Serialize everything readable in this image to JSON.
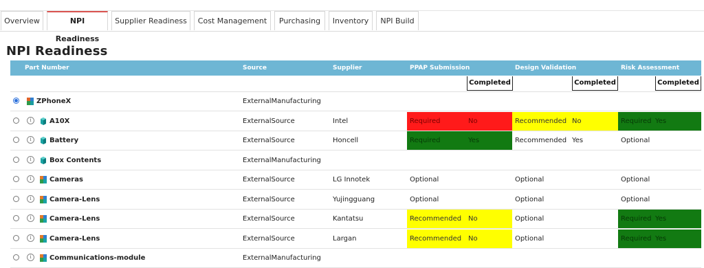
{
  "tabs": [
    {
      "label": "Overview",
      "active": false
    },
    {
      "label": "NPI Readiness",
      "active": true
    },
    {
      "label": "Supplier Readiness",
      "active": false
    },
    {
      "label": "Cost Management",
      "active": false
    },
    {
      "label": "Purchasing",
      "active": false
    },
    {
      "label": "Inventory",
      "active": false
    },
    {
      "label": "NPI Build",
      "active": false
    }
  ],
  "page_title": "NPI Readiness",
  "columns": {
    "part_number": "Part Number",
    "source": "Source",
    "supplier": "Supplier",
    "ppap": "PPAP Submission",
    "design": "Design Validation",
    "risk": "Risk Assessment"
  },
  "sub_header": {
    "ppap": "Completed",
    "design": "Completed",
    "risk": "Completed"
  },
  "colors": {
    "header": "#6eb6d4",
    "required_no": "#ff1a1a",
    "yes": "#127a12",
    "recommended": "#ffff00",
    "active_tab": "#d9534f"
  },
  "rows": [
    {
      "part": "ZPhoneX",
      "selected": true,
      "info": false,
      "icon": "product-icon",
      "source": "ExternalManufacturing",
      "supplier": "",
      "ppap": {
        "level": "",
        "status": "",
        "color": ""
      },
      "design": {
        "level": "",
        "status": "",
        "color": ""
      },
      "risk": {
        "level": "",
        "status": "",
        "color": ""
      }
    },
    {
      "part": "A10X",
      "selected": false,
      "info": true,
      "icon": "part-icon",
      "source": "ExternalSource",
      "supplier": "Intel",
      "ppap": {
        "level": "Required",
        "status": "No",
        "color": "red"
      },
      "design": {
        "level": "Recommended",
        "status": "No",
        "color": "yellow"
      },
      "risk": {
        "level": "Required",
        "status": "Yes",
        "color": "green"
      }
    },
    {
      "part": "Battery",
      "selected": false,
      "info": true,
      "icon": "part-icon",
      "source": "ExternalSource",
      "supplier": "Honcell",
      "ppap": {
        "level": "Required",
        "status": "Yes",
        "color": "green"
      },
      "design": {
        "level": "Recommended",
        "status": "Yes",
        "color": ""
      },
      "risk": {
        "level": "Optional",
        "status": "",
        "color": ""
      }
    },
    {
      "part": "Box Contents",
      "selected": false,
      "info": true,
      "icon": "part-icon",
      "source": "ExternalManufacturing",
      "supplier": "",
      "ppap": {
        "level": "",
        "status": "",
        "color": ""
      },
      "design": {
        "level": "",
        "status": "",
        "color": ""
      },
      "risk": {
        "level": "",
        "status": "",
        "color": ""
      }
    },
    {
      "part": "Cameras",
      "selected": false,
      "info": true,
      "icon": "assembly-icon",
      "source": "ExternalSource",
      "supplier": "LG Innotek",
      "ppap": {
        "level": "Optional",
        "status": "",
        "color": ""
      },
      "design": {
        "level": "Optional",
        "status": "",
        "color": ""
      },
      "risk": {
        "level": "Optional",
        "status": "",
        "color": ""
      }
    },
    {
      "part": "Camera-Lens",
      "selected": false,
      "info": true,
      "icon": "assembly-icon",
      "source": "ExternalSource",
      "supplier": "Yujingguang",
      "ppap": {
        "level": "Optional",
        "status": "",
        "color": ""
      },
      "design": {
        "level": "Optional",
        "status": "",
        "color": ""
      },
      "risk": {
        "level": "Optional",
        "status": "",
        "color": ""
      }
    },
    {
      "part": "Camera-Lens",
      "selected": false,
      "info": true,
      "icon": "assembly-icon",
      "source": "ExternalSource",
      "supplier": "Kantatsu",
      "ppap": {
        "level": "Recommended",
        "status": "No",
        "color": "yellow"
      },
      "design": {
        "level": "Optional",
        "status": "",
        "color": ""
      },
      "risk": {
        "level": "Required",
        "status": "Yes",
        "color": "green"
      }
    },
    {
      "part": "Camera-Lens",
      "selected": false,
      "info": true,
      "icon": "assembly-icon",
      "source": "ExternalSource",
      "supplier": "Largan",
      "ppap": {
        "level": "Recommended",
        "status": "No",
        "color": "yellow"
      },
      "design": {
        "level": "Optional",
        "status": "",
        "color": ""
      },
      "risk": {
        "level": "Required",
        "status": "Yes",
        "color": "green"
      }
    },
    {
      "part": "Communications-module",
      "selected": false,
      "info": true,
      "icon": "assembly-icon",
      "source": "ExternalManufacturing",
      "supplier": "",
      "ppap": {
        "level": "",
        "status": "",
        "color": ""
      },
      "design": {
        "level": "",
        "status": "",
        "color": ""
      },
      "risk": {
        "level": "",
        "status": "",
        "color": ""
      }
    }
  ]
}
